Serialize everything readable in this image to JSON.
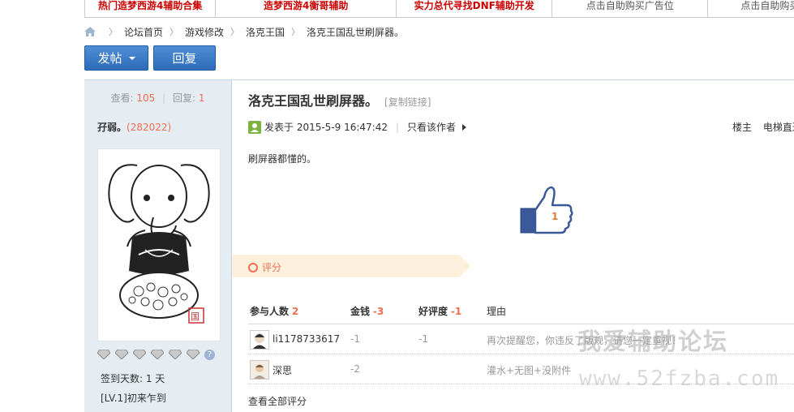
{
  "ads": [
    {
      "label": "热门造梦西游4辅助合集",
      "color": "#c00",
      "width": 161,
      "bold": true
    },
    {
      "label": "造梦西游4衡哥辅助",
      "color": "#c00",
      "width": 223,
      "bold": true
    },
    {
      "label": "实力总代寻找DNF辅助开发",
      "color": "#c00",
      "width": 192,
      "bold": true
    },
    {
      "label": "点击自助购买广告位",
      "color": "#555",
      "width": 192,
      "bold": false
    },
    {
      "label": "点击自助购买广告位",
      "color": "#555",
      "width": 107,
      "bold": false
    }
  ],
  "breadcrumb": {
    "items": [
      "论坛首页",
      "游戏修改",
      "洛克王国",
      "洛克王国乱世刷屏器。"
    ]
  },
  "buttons": {
    "post": "发帖",
    "reply": "回复"
  },
  "sidebar": {
    "views_label": "查看:",
    "views": "105",
    "replies_label": "回复:",
    "replies": "1",
    "author": "孖弱。",
    "uid": "(282022)",
    "signin": "签到天数: 1 天",
    "level": "[LV.1]初来乍到",
    "help_icon": "?"
  },
  "post": {
    "title": "洛克王国乱世刷屏器。",
    "copy_link": "[复制链接]",
    "posted": "发表于 2015-5-9 16:47:42",
    "only_author": "只看该作者",
    "floor": "楼主",
    "elevator": "电梯直达",
    "body": "刷屏器都懂的。",
    "like_count": "1"
  },
  "rating": {
    "title": "评分",
    "header": {
      "participants": "参与人数",
      "participants_n": "2",
      "gold": "金钱",
      "gold_n": "-3",
      "rep": "好评度",
      "rep_n": "-1",
      "reason": "理由"
    },
    "rows": [
      {
        "user": "li1178733617",
        "gold": "-1",
        "rep": "-1",
        "reason": "再次提醒您，你违反了版规，请您一定重视！"
      },
      {
        "user": "深思",
        "gold": "-2",
        "rep": "",
        "reason": "灌水+无图+没附件"
      }
    ],
    "view_all": "查看全部评分"
  },
  "watermark": {
    "line1": "我爱辅助论坛",
    "line2": "www.52fzba.com"
  },
  "colors": {
    "accent": "#f26c4f",
    "button": "#2d6bb8",
    "sidebar": "#e5edf2",
    "ad_red": "#c00"
  }
}
